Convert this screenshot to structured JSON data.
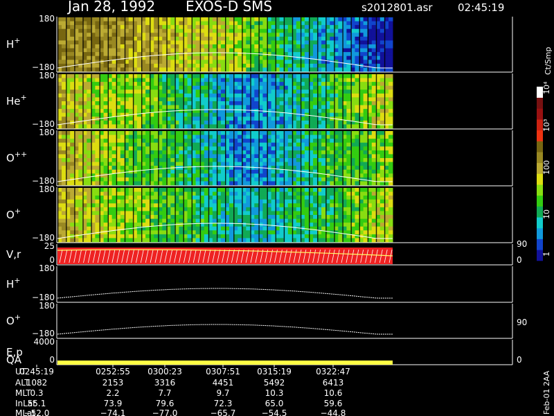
{
  "header": {
    "date": "Jan 28, 1992",
    "instrument": "EXOS-D SMS",
    "file": "s2012801.asr",
    "time": "02:45:19"
  },
  "colors": {
    "background": "#000000",
    "foreground": "#ffffff",
    "qa_bar": "#ffff44",
    "trace": "#ffffff",
    "velocity_bg": "#ee2222",
    "velocity_arrow": "#ffff66"
  },
  "colorbar": {
    "unit_label": "Ct/Smp",
    "ticks": [
      "1",
      "10",
      "100",
      "10³",
      "10⁴"
    ],
    "colors": [
      "#111199",
      "#1144cc",
      "#1199dd",
      "#11cccc",
      "#11aa55",
      "#33cc11",
      "#88dd11",
      "#dddd11",
      "#bbaa33",
      "#998822",
      "#776611",
      "#ee3311",
      "#cc2211",
      "#991111",
      "#771111",
      "#ffffff"
    ]
  },
  "chart_data": {
    "type": "heatmap",
    "title": "Jan 28, 1992   EXOS-D SMS",
    "panels": [
      {
        "name": "H+",
        "label_base": "H",
        "label_sup": "+",
        "ymax_label": "180",
        "ymin_label": "−180",
        "kind": "spectrogram",
        "profile": [
          9,
          9,
          9,
          8,
          8,
          7,
          7,
          6,
          5,
          4,
          3,
          2,
          1,
          0
        ]
      },
      {
        "name": "He+",
        "label_base": "He",
        "label_sup": "+",
        "ymax_label": "180",
        "ymin_label": "−180",
        "kind": "spectrogram",
        "profile": [
          8,
          7,
          6,
          6,
          5,
          4,
          3,
          2,
          2,
          3,
          4,
          5,
          6,
          7
        ]
      },
      {
        "name": "O++",
        "label_base": "O",
        "label_sup": "++",
        "ymax_label": "180",
        "ymin_label": "−180",
        "kind": "spectrogram",
        "profile": [
          8,
          7,
          6,
          5,
          5,
          4,
          3,
          2,
          2,
          3,
          4,
          5,
          5,
          6
        ]
      },
      {
        "name": "O+",
        "label_base": "O",
        "label_sup": "+",
        "ymax_label": "180",
        "ymin_label": "−180",
        "kind": "spectrogram",
        "profile": [
          8,
          7,
          6,
          6,
          5,
          5,
          4,
          3,
          3,
          4,
          4,
          5,
          6,
          7
        ]
      },
      {
        "name": "V,r",
        "label_base": "V,r",
        "label_sup": "",
        "ymax_label": "25",
        "ymin_label": "0",
        "kind": "velocity",
        "right_max": "90",
        "right_min": "0"
      },
      {
        "name": "H+",
        "label_base": "H",
        "label_sup": "+",
        "ymax_label": "180",
        "ymin_label": "−180",
        "kind": "trace"
      },
      {
        "name": "O+",
        "label_base": "O",
        "label_sup": "+",
        "ymax_label": "180",
        "ymin_label": "−180",
        "kind": "trace",
        "right_mid": "90"
      },
      {
        "name": "E,p",
        "label_base": "E,p",
        "label_sup": "",
        "ymax_label": "4000",
        "ymin_label": "0",
        "kind": "qa",
        "right_min": "0"
      }
    ],
    "qa_label": "QA",
    "time_axis": {
      "row_labels": [
        "UT",
        "ALT",
        "MLT",
        "InLat",
        "MLat"
      ],
      "ticks": [
        {
          "UT": "0245:19",
          "ALT": "1082",
          "MLT": "0.3",
          "InLat": "55.1",
          "MLat": "−52.0"
        },
        {
          "UT": "0252:55",
          "ALT": "2153",
          "MLT": "2.2",
          "InLat": "73.9",
          "MLat": "−74.1"
        },
        {
          "UT": "0300:23",
          "ALT": "3316",
          "MLT": "7.7",
          "InLat": "79.6",
          "MLat": "−77.0"
        },
        {
          "UT": "0307:51",
          "ALT": "4451",
          "MLT": "9.7",
          "InLat": "72.3",
          "MLat": "−65.7"
        },
        {
          "UT": "0315:19",
          "ALT": "5492",
          "MLT": "10.3",
          "InLat": "65.0",
          "MLat": "−54.5"
        },
        {
          "UT": "0322:47",
          "ALT": "6413",
          "MLT": "10.6",
          "InLat": "59.6",
          "MLat": "−44.8"
        }
      ]
    }
  },
  "footer": {
    "version": "Feb-01 2AA"
  }
}
